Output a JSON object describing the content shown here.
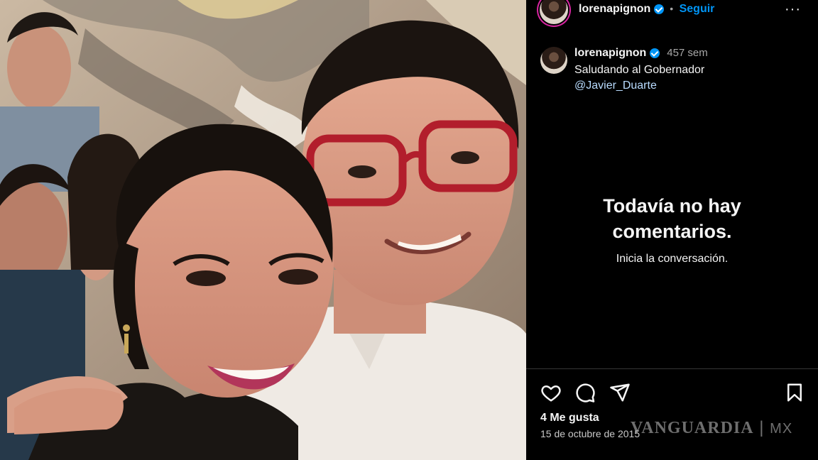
{
  "post": {
    "photo_alt": "Selfie of a smiling woman and a man with red glasses in front of a mural"
  },
  "header": {
    "username": "lorenapignon",
    "separator": "•",
    "follow_label": "Seguir",
    "more_label": "···"
  },
  "caption": {
    "username": "lorenapignon",
    "time": "457 sem",
    "text": "Saludando al Gobernador",
    "mention": "@Javier_Duarte"
  },
  "comments": {
    "empty_title": "Todavía no hay comentarios.",
    "empty_subtitle": "Inicia la conversación."
  },
  "footer": {
    "likes": "4 Me gusta",
    "date": "15 de octubre de 2015"
  },
  "icons": {
    "like": "heart-icon",
    "comment": "comment-icon",
    "share": "send-icon",
    "save": "bookmark-icon"
  },
  "watermark": {
    "brand": "VANGUARDIA",
    "suffix": "MX"
  },
  "colors": {
    "accent": "#0095f6",
    "background": "#000000",
    "frame_accent": "#c8102e"
  }
}
